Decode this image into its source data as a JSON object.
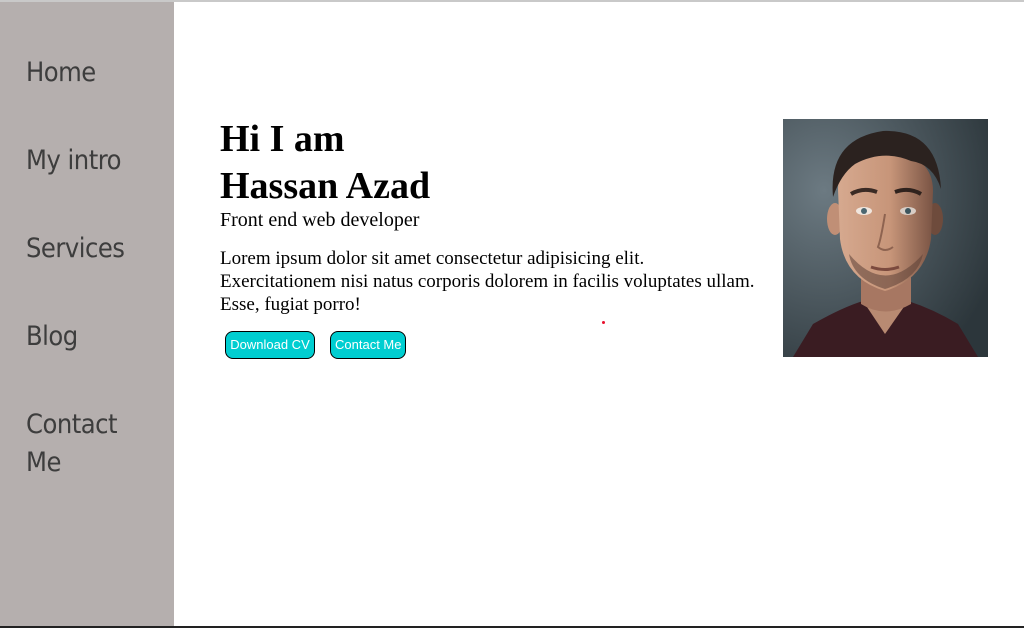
{
  "sidebar": {
    "items": [
      {
        "label": "Home"
      },
      {
        "label": "My intro"
      },
      {
        "label": "Services"
      },
      {
        "label": "Blog"
      },
      {
        "label": "Contact Me"
      }
    ]
  },
  "hero": {
    "greeting": "Hi I am",
    "name": "Hassan Azad",
    "role": "Front end web developer",
    "intro_lines": [
      "Lorem ipsum dolor sit amet consectetur adipisicing elit.",
      "Exercitationem nisi natus corporis dolorem in facilis voluptates ullam.",
      "Esse, fugiat porro!"
    ],
    "buttons": {
      "download_cv": "Download CV",
      "contact_me": "Contact Me"
    },
    "portrait_icon": "person-portrait"
  },
  "colors": {
    "sidebar_bg": "#b5afae",
    "nav_text": "#3d3d3d",
    "button_bg": "#00ced1",
    "button_text": "#ffffff"
  }
}
